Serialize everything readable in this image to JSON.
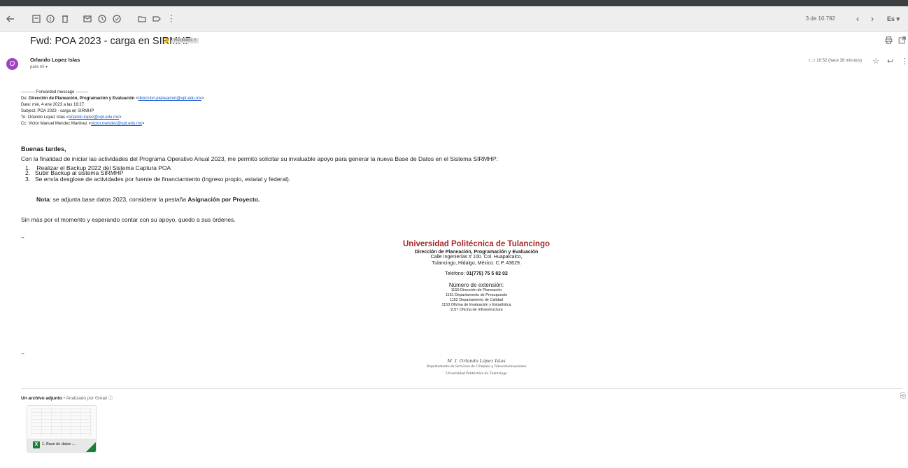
{
  "header": {
    "pager": "3 de 10.792",
    "prev_icon": "chevron-left-icon",
    "next_icon": "chevron-right-icon",
    "lang_label": "Es"
  },
  "email": {
    "subject": "Fwd: POA 2023 - carga en SIRMHP",
    "label_chip": "Recibidos ×",
    "sender_initial": "O",
    "sender_name": "Orlando Lopez Islas",
    "recipient": "para mí ▾",
    "time": "10:52 (hace 36 minutos)",
    "avatar_color": "#a142c6"
  },
  "forward": {
    "header_line": "---------- Forwarded message ---------",
    "from_prefix": "De: ",
    "from_name": "Dirección de Planeación, Programación y Evaluación",
    "from_email": "direccion.planeacion@upt.edu.mx",
    "date": "Date: mié, 4 ene 2023 a las 19:27",
    "subject": "Subject: POA 2023 - carga en SIRMHP",
    "to_prefix": "To: Orlando Lopez Islas <",
    "to_email": "orlando.lopez@upt.edu.mx",
    "cc_prefix": "Cc: Victor Manuel Mendez Martinez <",
    "cc_email": "victor.mendez@upt.edu.mx"
  },
  "body": {
    "greeting": "Buenas tardes,",
    "intro": "Con la finalidad de iniciar las actividades del Programa Operativo Anual 2023, me permito solicitar su invaluable apoyo para generar la nueva Base de Datos en el Sistema SIRMHP:",
    "items": [
      {
        "num": "1.",
        "text": " Realizar el Backup 2022 del Sistema Captura POA"
      },
      {
        "num": "2.",
        "text": "Subir Backup al sistema SIRMHP"
      },
      {
        "num": "3.",
        "text": "Se envía desglose de actividades por fuente de financiamiento (ingreso propio, estatal y federal)."
      }
    ],
    "nota_bold": "Nota",
    "nota_text": ": se adjunta base datos 2023, considerar la pestaña ",
    "nota_emph": "Asignación por Proyecto.",
    "closing": "Sin más por el momento y esperando contar con su apoyo, quedo a sus órdenes.",
    "dash": "--"
  },
  "signature": {
    "university": "Universidad Politécnica de Tulancingo",
    "department": "Dirección de Planeación, Programación y Evaluación",
    "address1": "Calle Ingenierías # 100. Col. Huapalcalco,",
    "address2": "Tulancingo, Hidalgo, México. C.P. 43629.",
    "phone_label": "Teléfono: ",
    "phone": "01(775) 75 5 82 02",
    "ext_title": "Número de extensión:",
    "extensions": [
      "1150 Dirección de Planeación",
      "1151 Departamento de Presupuesto",
      "1152 Departamento de Calidad",
      "1153 Oficina de Evaluación y Estadística",
      "1157 Oficina de Infraestructura"
    ],
    "accent_color": "#a52a2a"
  },
  "signature2": {
    "dash": "--",
    "name": "M. I. Orlando López Islas",
    "department": "Departamento de Servicios de Cómputo y Telecomunicaciones",
    "university": "Universidad Politécnica de Tulancingo"
  },
  "attachments": {
    "title": "Un archivo adjunto",
    "scanned": " • Analizado por Gmail ⓘ",
    "file_name": "1. Base de datos ...",
    "file_type_icon": "X"
  }
}
